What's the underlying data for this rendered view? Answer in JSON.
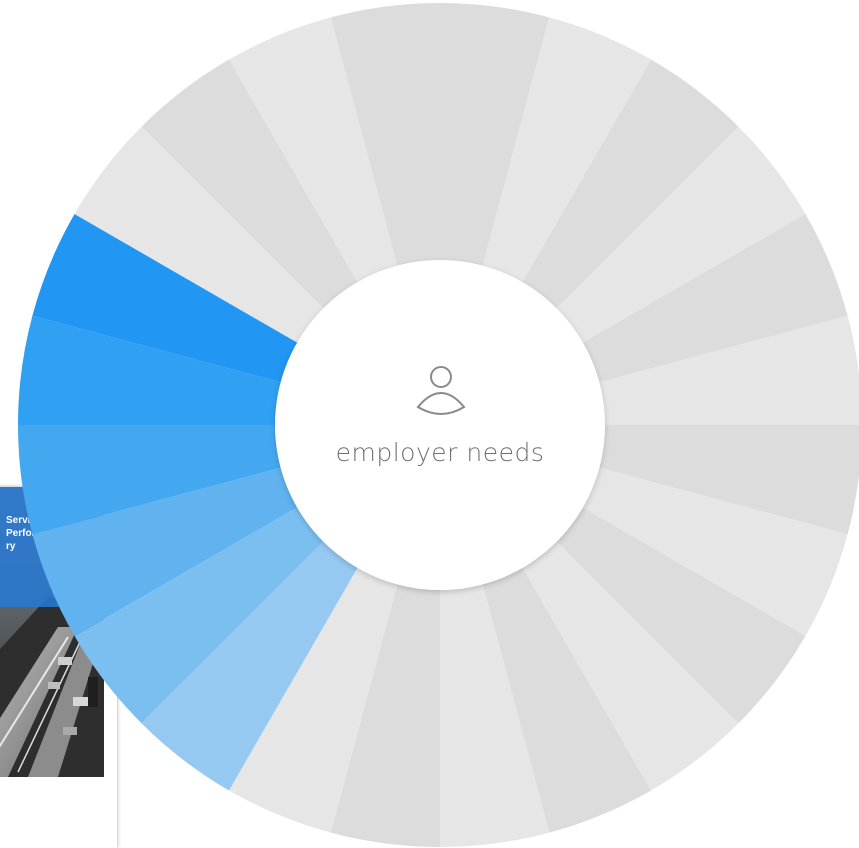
{
  "center": {
    "label": "employer needs",
    "icon": "person-icon"
  },
  "wheel": {
    "segment_count": 24,
    "segments": [
      {
        "index": 0,
        "state": "inactive",
        "color": "#dcdcdc"
      },
      {
        "index": 1,
        "state": "inactive",
        "color": "#e6e6e6"
      },
      {
        "index": 2,
        "state": "inactive",
        "color": "#dcdcdc"
      },
      {
        "index": 3,
        "state": "inactive",
        "color": "#e6e6e6"
      },
      {
        "index": 4,
        "state": "inactive",
        "color": "#dcdcdc"
      },
      {
        "index": 5,
        "state": "inactive",
        "color": "#e6e6e6"
      },
      {
        "index": 6,
        "state": "inactive",
        "color": "#dcdcdc"
      },
      {
        "index": 7,
        "state": "inactive",
        "color": "#e6e6e6"
      },
      {
        "index": 8,
        "state": "inactive",
        "color": "#dcdcdc"
      },
      {
        "index": 9,
        "state": "inactive",
        "color": "#e6e6e6"
      },
      {
        "index": 10,
        "state": "inactive",
        "color": "#dcdcdc"
      },
      {
        "index": 11,
        "state": "inactive",
        "color": "#e6e6e6"
      },
      {
        "index": 12,
        "state": "inactive",
        "color": "#dcdcdc"
      },
      {
        "index": 13,
        "state": "inactive",
        "color": "#e6e6e6"
      },
      {
        "index": 14,
        "state": "active",
        "color": "#95c9f2"
      },
      {
        "index": 15,
        "state": "active",
        "color": "#7bbff0"
      },
      {
        "index": 16,
        "state": "active",
        "color": "#60b3ef"
      },
      {
        "index": 17,
        "state": "active",
        "color": "#43a8f0"
      },
      {
        "index": 18,
        "state": "active",
        "color": "#30a0f3"
      },
      {
        "index": 19,
        "state": "active",
        "color": "#2196f3"
      },
      {
        "index": 20,
        "state": "inactive",
        "color": "#e6e6e6"
      },
      {
        "index": 21,
        "state": "inactive",
        "color": "#dcdcdc"
      },
      {
        "index": 22,
        "state": "inactive",
        "color": "#e6e6e6"
      },
      {
        "index": 23,
        "state": "inactive",
        "color": "#dcdcdc"
      }
    ]
  },
  "report_card": {
    "title": "Service\nPerformance\nry"
  },
  "colors": {
    "center_fill": "#ffffff",
    "center_text": "#707070",
    "accent": "#2196f3"
  }
}
